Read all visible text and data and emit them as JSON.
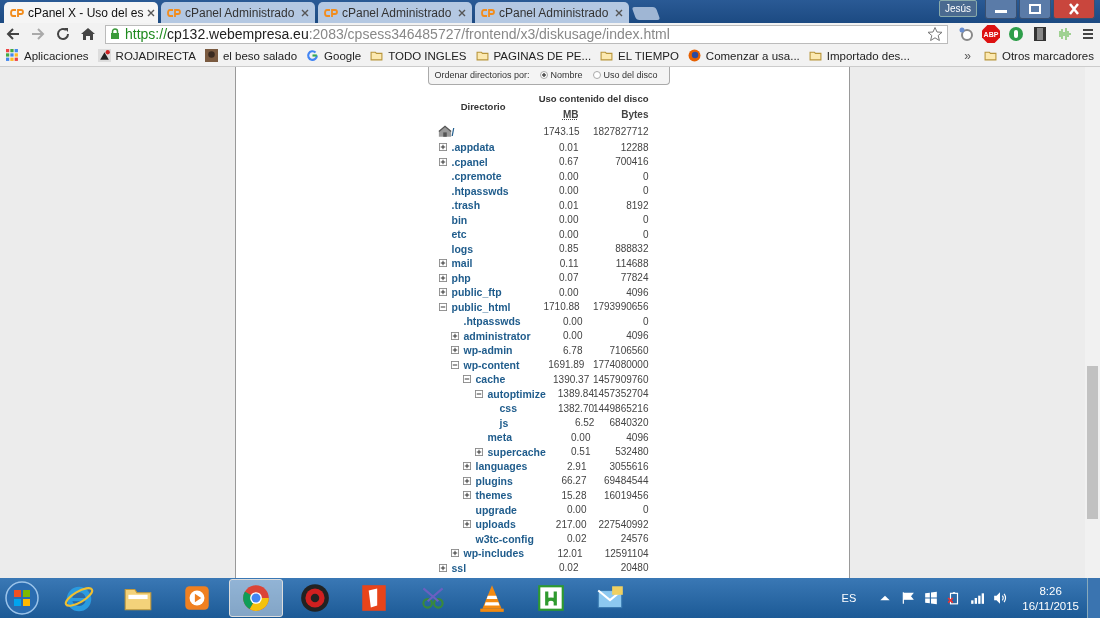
{
  "browser": {
    "tabs": [
      {
        "title": "cPanel X - Uso del es",
        "selected": true
      },
      {
        "title": "cPanel Administrado",
        "selected": false
      },
      {
        "title": "cPanel Administrado",
        "selected": false
      },
      {
        "title": "cPanel Administrado",
        "selected": false
      }
    ],
    "user": "Jesús",
    "url": {
      "scheme": "https://",
      "host": "cp132.webempresa.eu",
      "path": ":2083/cpsess346485727/frontend/x3/diskusage/index.html"
    },
    "extensions": [
      {
        "kind": "search"
      },
      {
        "kind": "abp",
        "label": "ABP"
      },
      {
        "kind": "circle"
      },
      {
        "kind": "film"
      },
      {
        "kind": "wave"
      }
    ],
    "bookmarks": [
      {
        "kind": "apps",
        "label": "Aplicaciones"
      },
      {
        "kind": "site",
        "label": "ROJADIRECTA"
      },
      {
        "kind": "photo",
        "label": "el beso salado"
      },
      {
        "kind": "google",
        "label": "Google"
      },
      {
        "kind": "folder",
        "label": "TODO INGLES"
      },
      {
        "kind": "folder",
        "label": "PAGINAS DE PE..."
      },
      {
        "kind": "folder",
        "label": "EL TIEMPO"
      },
      {
        "kind": "firefox",
        "label": "Comenzar a usa..."
      },
      {
        "kind": "folder",
        "label": "Importado des..."
      }
    ],
    "more_bookmarks": "»",
    "other_bookmarks": "Otros marcadores"
  },
  "page": {
    "sort": {
      "label": "Ordenar directorios por:",
      "options": [
        {
          "label": "Nombre",
          "selected": true
        },
        {
          "label": "Uso del disco",
          "selected": false
        }
      ]
    },
    "headers": {
      "directory": "Directorio",
      "usage": "Uso contenido del disco",
      "mb": "MB",
      "bytes": "Bytes"
    },
    "root": {
      "name": "/",
      "mb": "1743.15",
      "bytes": "1827827712"
    },
    "directories": [
      {
        "name": ".appdata",
        "mb": "0.01",
        "bytes": "12288",
        "kind": "toggle",
        "expanded": false
      },
      {
        "name": ".cpanel",
        "mb": "0.67",
        "bytes": "700416",
        "kind": "toggle",
        "expanded": false
      },
      {
        "name": ".cpremote",
        "mb": "0.00",
        "bytes": "0",
        "kind": "plain"
      },
      {
        "name": ".htpasswds",
        "mb": "0.00",
        "bytes": "0",
        "kind": "plain"
      },
      {
        "name": ".trash",
        "mb": "0.01",
        "bytes": "8192",
        "kind": "plain"
      },
      {
        "name": "bin",
        "mb": "0.00",
        "bytes": "0",
        "kind": "plain"
      },
      {
        "name": "etc",
        "mb": "0.00",
        "bytes": "0",
        "kind": "plain"
      },
      {
        "name": "logs",
        "mb": "0.85",
        "bytes": "888832",
        "kind": "plain"
      },
      {
        "name": "mail",
        "mb": "0.11",
        "bytes": "114688",
        "kind": "toggle",
        "expanded": false
      },
      {
        "name": "php",
        "mb": "0.07",
        "bytes": "77824",
        "kind": "toggle",
        "expanded": false
      },
      {
        "name": "public_ftp",
        "mb": "0.00",
        "bytes": "4096",
        "kind": "toggle",
        "expanded": false
      },
      {
        "name": "public_html",
        "mb": "1710.88",
        "bytes": "1793990656",
        "kind": "toggle",
        "expanded": true,
        "children": [
          {
            "name": ".htpasswds",
            "mb": "0.00",
            "bytes": "0",
            "kind": "plain"
          },
          {
            "name": "administrator",
            "mb": "0.00",
            "bytes": "4096",
            "kind": "toggle",
            "expanded": false
          },
          {
            "name": "wp-admin",
            "mb": "6.78",
            "bytes": "7106560",
            "kind": "toggle",
            "expanded": false
          },
          {
            "name": "wp-content",
            "mb": "1691.89",
            "bytes": "1774080000",
            "kind": "toggle",
            "expanded": true,
            "children": [
              {
                "name": "cache",
                "mb": "1390.37",
                "bytes": "1457909760",
                "kind": "toggle",
                "expanded": true,
                "children": [
                  {
                    "name": "autoptimize",
                    "mb": "1389.84",
                    "bytes": "1457352704",
                    "kind": "toggle",
                    "expanded": true,
                    "children": [
                      {
                        "name": "css",
                        "mb": "1382.70",
                        "bytes": "1449865216",
                        "kind": "plain"
                      },
                      {
                        "name": "js",
                        "mb": "6.52",
                        "bytes": "6840320",
                        "kind": "plain"
                      }
                    ]
                  },
                  {
                    "name": "meta",
                    "mb": "0.00",
                    "bytes": "4096",
                    "kind": "plain"
                  },
                  {
                    "name": "supercache",
                    "mb": "0.51",
                    "bytes": "532480",
                    "kind": "toggle",
                    "expanded": false
                  }
                ]
              },
              {
                "name": "languages",
                "mb": "2.91",
                "bytes": "3055616",
                "kind": "toggle",
                "expanded": false
              },
              {
                "name": "plugins",
                "mb": "66.27",
                "bytes": "69484544",
                "kind": "toggle",
                "expanded": false
              },
              {
                "name": "themes",
                "mb": "15.28",
                "bytes": "16019456",
                "kind": "toggle",
                "expanded": false
              },
              {
                "name": "upgrade",
                "mb": "0.00",
                "bytes": "0",
                "kind": "plain"
              },
              {
                "name": "uploads",
                "mb": "217.00",
                "bytes": "227540992",
                "kind": "toggle",
                "expanded": false
              },
              {
                "name": "w3tc-config",
                "mb": "0.02",
                "bytes": "24576",
                "kind": "plain"
              }
            ]
          },
          {
            "name": "wp-includes",
            "mb": "12.01",
            "bytes": "12591104",
            "kind": "toggle",
            "expanded": false
          }
        ]
      },
      {
        "name": "ssl",
        "mb": "0.02",
        "bytes": "20480",
        "kind": "toggle",
        "expanded": false
      }
    ]
  },
  "taskbar": {
    "apps": [
      {
        "kind": "ie",
        "selected": false
      },
      {
        "kind": "explorer",
        "selected": false
      },
      {
        "kind": "player",
        "selected": false
      },
      {
        "kind": "chrome",
        "selected": true
      },
      {
        "kind": "redcircle",
        "selected": false
      },
      {
        "kind": "pdf",
        "selected": false
      },
      {
        "kind": "mp3",
        "selected": false
      },
      {
        "kind": "vlc",
        "selected": false
      },
      {
        "kind": "torrent",
        "selected": false
      },
      {
        "kind": "mail",
        "selected": false
      }
    ],
    "language": "ES",
    "time": "8:26",
    "date": "16/11/2015"
  }
}
